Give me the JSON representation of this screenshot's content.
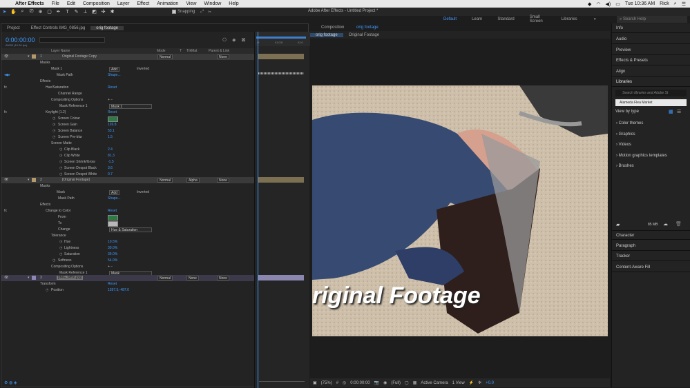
{
  "menubar": {
    "apple": "",
    "app": "After Effects",
    "items": [
      "File",
      "Edit",
      "Composition",
      "Layer",
      "Effect",
      "Animation",
      "View",
      "Window",
      "Help"
    ],
    "clock": "Tue 10:36 AM",
    "user": "Rick"
  },
  "toolbar": {
    "title": "Adobe After Effects - Untitled Project *",
    "snapping": "Snapping"
  },
  "workspaces": {
    "items": [
      "Default",
      "Learn",
      "Standard",
      "Small Screen",
      "Libraries"
    ],
    "active": "Default",
    "search_placeholder": "Search Help"
  },
  "leftpanel": {
    "tabs": [
      "Project",
      "Effect Controls IMG_0856.jpg",
      "orig footage"
    ],
    "timecode": "0:00:00:00",
    "frames": "00000 (10.00 fps)",
    "columns": [
      "Layer Name",
      "Mode",
      "T",
      "TrkMat",
      "Parent & Link"
    ]
  },
  "layers": {
    "l1": {
      "num": "1",
      "name": "Original Footage Copy",
      "mode": "Normal",
      "parent": "None",
      "masks": "Masks",
      "mask1": "Mask 1",
      "mask_mode": "Add",
      "inverted": "Inverted",
      "mask_path": "Mask Path",
      "shape": "Shape...",
      "effects": "Effects",
      "huesat": "Hue/Saturation",
      "reset": "Reset",
      "channel_range": "Channel Range",
      "comp_opts": "Compositing Options",
      "mask_ref": "Mask Reference 1",
      "mask_ref_val": "Mask 1",
      "keylight": "Keylight (1.2)",
      "screen_colour": "Screen Colour",
      "screen_gain": "Screen Gain",
      "screen_gain_v": "126.8",
      "screen_balance": "Screen Balance",
      "screen_balance_v": "53.1",
      "screen_preblur": "Screen Pre-blur",
      "screen_preblur_v": "1.5",
      "screen_matte": "Screen Matte",
      "clip_black": "Clip Black",
      "clip_black_v": "2.4",
      "clip_white": "Clip White",
      "clip_white_v": "81.3",
      "shrink": "Screen Shrink/Grow",
      "shrink_v": "-1.5",
      "despot_black": "Screen Despot Black",
      "despot_black_v": "3.6",
      "despot_white": "Screen Despot White",
      "despot_white_v": "0.7"
    },
    "l2": {
      "num": "2",
      "name": "[Original Footage]",
      "mode": "Normal",
      "trkmat": "Alpha",
      "parent": "None",
      "masks": "Masks",
      "mask": "Mask",
      "mask_mode": "Add",
      "inverted": "Inverted",
      "mask_path": "Mask Path",
      "shape": "Shape...",
      "effects": "Effects",
      "ctc": "Change to Color",
      "reset": "Reset",
      "from": "From",
      "to": "To",
      "change": "Change",
      "change_val": "Hue & Saturation",
      "tolerance": "Tolerance",
      "hue": "Hue",
      "hue_v": "10.5%",
      "lightness": "Lightness",
      "lightness_v": "30.0%",
      "saturation": "Saturation",
      "saturation_v": "39.0%",
      "softness": "Softness",
      "softness_v": "54.0%",
      "comp_opts": "Compositing Options",
      "mask_ref": "Mask Reference 1",
      "mask_ref_val": "Mask"
    },
    "l3": {
      "num": "3",
      "name": "[IMG_0856.jpg]",
      "mode": "Normal",
      "trkmat": "None",
      "parent": "None",
      "transform": "Transform",
      "reset": "Reset",
      "position": "Position",
      "position_v": "1397.5,-487.0"
    }
  },
  "timeline": {
    "ticks": [
      "0f",
      "01:03f",
      "02:0"
    ]
  },
  "viewer": {
    "tab_prefix": "Composition",
    "tab_name": "orig footage",
    "subtabs": [
      "orig footage",
      "Original Footage"
    ],
    "overlay_text": "riginal Footage",
    "bottom": {
      "zoom": "(75%)",
      "time": "0:00:00:00",
      "quality": "(Full)",
      "camera": "Active Camera",
      "views": "1 View",
      "exposure": "+0.0"
    }
  },
  "rightpanel": {
    "panels_top": [
      "Info",
      "Audio",
      "Preview",
      "Effects & Presets",
      "Align",
      "Libraries"
    ],
    "lib_search": "Search libraries and Adobe St",
    "library": "Alameda Flea Market",
    "viewtype": "View by type",
    "sections": [
      "Color themes",
      "Graphics",
      "Videos",
      "Motion graphics templates",
      "Brushes"
    ],
    "storage": "85 MB",
    "panels_bottom": [
      "Character",
      "Paragraph",
      "Tracker",
      "Content-Aware Fill"
    ]
  },
  "colors": {
    "accent": "#3e9bff",
    "label_tan": "#b49a6a",
    "label_purple": "#8e86b5"
  }
}
